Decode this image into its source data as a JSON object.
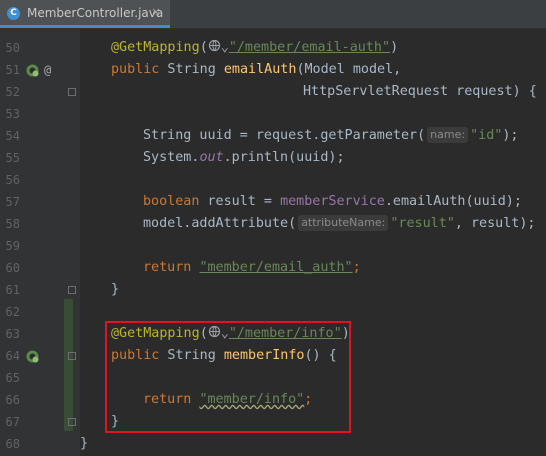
{
  "tab": {
    "icon": "java-class-icon",
    "icon_glyph": "C",
    "label": "MemberController.java",
    "close_glyph": "×"
  },
  "lines": [
    {
      "num": "50"
    },
    {
      "num": "51"
    },
    {
      "num": "52"
    },
    {
      "num": "53"
    },
    {
      "num": "54"
    },
    {
      "num": "55"
    },
    {
      "num": "56"
    },
    {
      "num": "57"
    },
    {
      "num": "58"
    },
    {
      "num": "59"
    },
    {
      "num": "60"
    },
    {
      "num": "61"
    },
    {
      "num": "62"
    },
    {
      "num": "63"
    },
    {
      "num": "64"
    },
    {
      "num": "65"
    },
    {
      "num": "66"
    },
    {
      "num": "67"
    },
    {
      "num": "68"
    }
  ],
  "code": {
    "l50": {
      "annotation": "@GetMapping",
      "open": "(",
      "path": "\"/member/email-auth\"",
      "close": ")"
    },
    "l51": {
      "kw": "public",
      "type": " String ",
      "method": "emailAuth",
      "rest": "(Model model,"
    },
    "l52": {
      "rest": "HttpServletRequest request) {"
    },
    "l54": {
      "pre": "String uuid = request.getParameter(",
      "hint": "name:",
      "str": "\"id\"",
      "post": ");"
    },
    "l55": {
      "pre": "System.",
      "field": "out",
      "post": ".println(uuid);"
    },
    "l57": {
      "kw": "boolean",
      "mid": " result = ",
      "field": "memberService",
      "post": ".emailAuth(uuid);"
    },
    "l58": {
      "pre": "model.addAttribute(",
      "hint": "attributeName:",
      "str": "\"result\"",
      "post": ", result);"
    },
    "l60": {
      "kw": "return",
      "str": "\"member/email_auth\"",
      "post": ";"
    },
    "l61": {
      "text": "}"
    },
    "l63": {
      "annotation": "@GetMapping",
      "open": "(",
      "path": "\"/member/info\"",
      "close": ")"
    },
    "l64": {
      "kw": "public",
      "type": " String ",
      "method": "memberInfo",
      "rest": "() {"
    },
    "l66": {
      "kw": "return",
      "str": "\"member/info\"",
      "post": ";"
    },
    "l67": {
      "text": "}"
    },
    "l68": {
      "text": "}"
    }
  },
  "gutter_icons": {
    "run": "spring-endpoint-icon",
    "mapping": "@"
  },
  "colors": {
    "highlight_box": "#e0141d",
    "keyword": "#cc7832",
    "annotation": "#bbb529",
    "string": "#6a8759"
  }
}
